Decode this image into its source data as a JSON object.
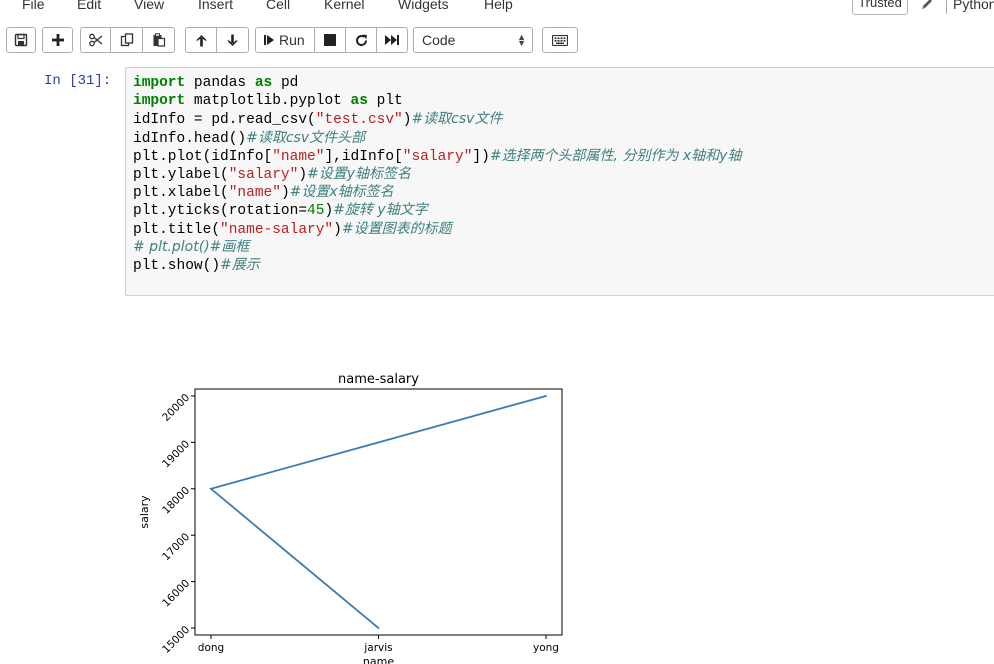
{
  "menu": {
    "items": [
      "File",
      "Edit",
      "View",
      "Insert",
      "Cell",
      "Kernel",
      "Widgets",
      "Help"
    ],
    "trusted": "Trusted",
    "kernel_name": "Python"
  },
  "toolbar": {
    "run_label": "Run",
    "cell_type": "Code",
    "icons": [
      "save-icon",
      "plus-icon",
      "cut-icon",
      "copy-icon",
      "paste-icon",
      "arrow-up-icon",
      "arrow-down-icon",
      "step-forward-icon",
      "stop-icon",
      "restart-icon",
      "fast-forward-icon",
      "keyboard-icon"
    ]
  },
  "cell": {
    "prompt": "In [31]:",
    "lines": [
      [
        {
          "t": "import",
          "c": "kw"
        },
        {
          "t": " pandas "
        },
        {
          "t": "as",
          "c": "kw"
        },
        {
          "t": " pd"
        }
      ],
      [
        {
          "t": "import",
          "c": "kw"
        },
        {
          "t": " matplotlib.pyplot "
        },
        {
          "t": "as",
          "c": "kw"
        },
        {
          "t": " plt"
        }
      ],
      [
        {
          "t": "idInfo = pd.read_csv("
        },
        {
          "t": "\"test.csv\"",
          "c": "str"
        },
        {
          "t": ")"
        },
        {
          "t": "#读取csv文件",
          "c": "cm"
        }
      ],
      [
        {
          "t": "idInfo.head()"
        },
        {
          "t": "#读取csv文件头部",
          "c": "cm"
        }
      ],
      [
        {
          "t": "plt.plot(idInfo["
        },
        {
          "t": "\"name\"",
          "c": "str"
        },
        {
          "t": "],idInfo["
        },
        {
          "t": "\"salary\"",
          "c": "str"
        },
        {
          "t": "])"
        },
        {
          "t": "#选择两个头部属性, 分别作为 x轴和y轴",
          "c": "cm"
        }
      ],
      [
        {
          "t": "plt.ylabel("
        },
        {
          "t": "\"salary\"",
          "c": "str"
        },
        {
          "t": ")"
        },
        {
          "t": "#设置y轴标签名",
          "c": "cm"
        }
      ],
      [
        {
          "t": "plt.xlabel("
        },
        {
          "t": "\"name\"",
          "c": "str"
        },
        {
          "t": ")"
        },
        {
          "t": "#设置x轴标签名",
          "c": "cm"
        }
      ],
      [
        {
          "t": "plt.yticks(rotation="
        },
        {
          "t": "45",
          "c": "num"
        },
        {
          "t": ")"
        },
        {
          "t": "#旋转 y轴文字",
          "c": "cm"
        }
      ],
      [
        {
          "t": "plt.title("
        },
        {
          "t": "\"name-salary\"",
          "c": "str"
        },
        {
          "t": ")"
        },
        {
          "t": "#设置图表的标题",
          "c": "cm"
        }
      ],
      [
        {
          "t": "# plt.plot()#画框",
          "c": "cm"
        }
      ],
      [
        {
          "t": "plt.show()"
        },
        {
          "t": "#展示",
          "c": "cm"
        }
      ]
    ]
  },
  "chart_data": {
    "type": "line",
    "title": "name-salary",
    "xlabel": "name",
    "ylabel": "salary",
    "categories": [
      "dong",
      "jarvis",
      "yong"
    ],
    "x": [
      "yong",
      "dong",
      "jarvis"
    ],
    "y": [
      20000,
      18000,
      15000
    ],
    "yticks": [
      15000,
      16000,
      17000,
      18000,
      19000,
      20000
    ],
    "ytick_rotation": 45,
    "ylim": [
      14850,
      20150
    ],
    "grid": false,
    "line_color": "#3b7bb1"
  }
}
